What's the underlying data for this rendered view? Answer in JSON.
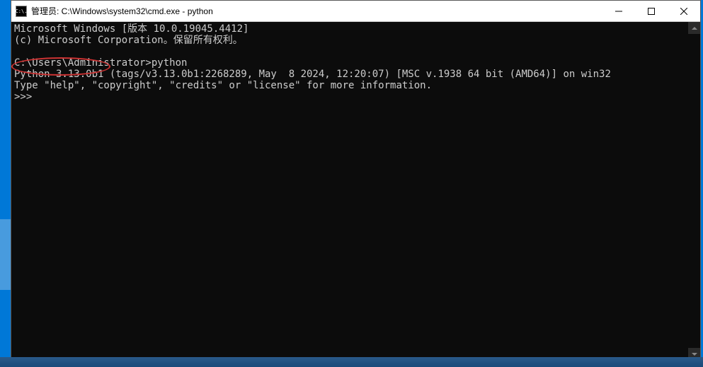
{
  "window": {
    "title": "管理员: C:\\Windows\\system32\\cmd.exe - python",
    "icon_label": "C:\\."
  },
  "terminal": {
    "line1": "Microsoft Windows [版本 10.0.19045.4412]",
    "line2": "(c) Microsoft Corporation。保留所有权利。",
    "blank1": "",
    "line3": "C:\\Users\\Administrator>python",
    "line4": "Python 3.13.0b1 (tags/v3.13.0b1:2268289, May  8 2024, 12:20:07) [MSC v.1938 64 bit (AMD64)] on win32",
    "line5": "Type \"help\", \"copyright\", \"credits\" or \"license\" for more information.",
    "line6": ">>>"
  },
  "annotation": {
    "highlighted_text": "Python 3.13.0b1"
  }
}
